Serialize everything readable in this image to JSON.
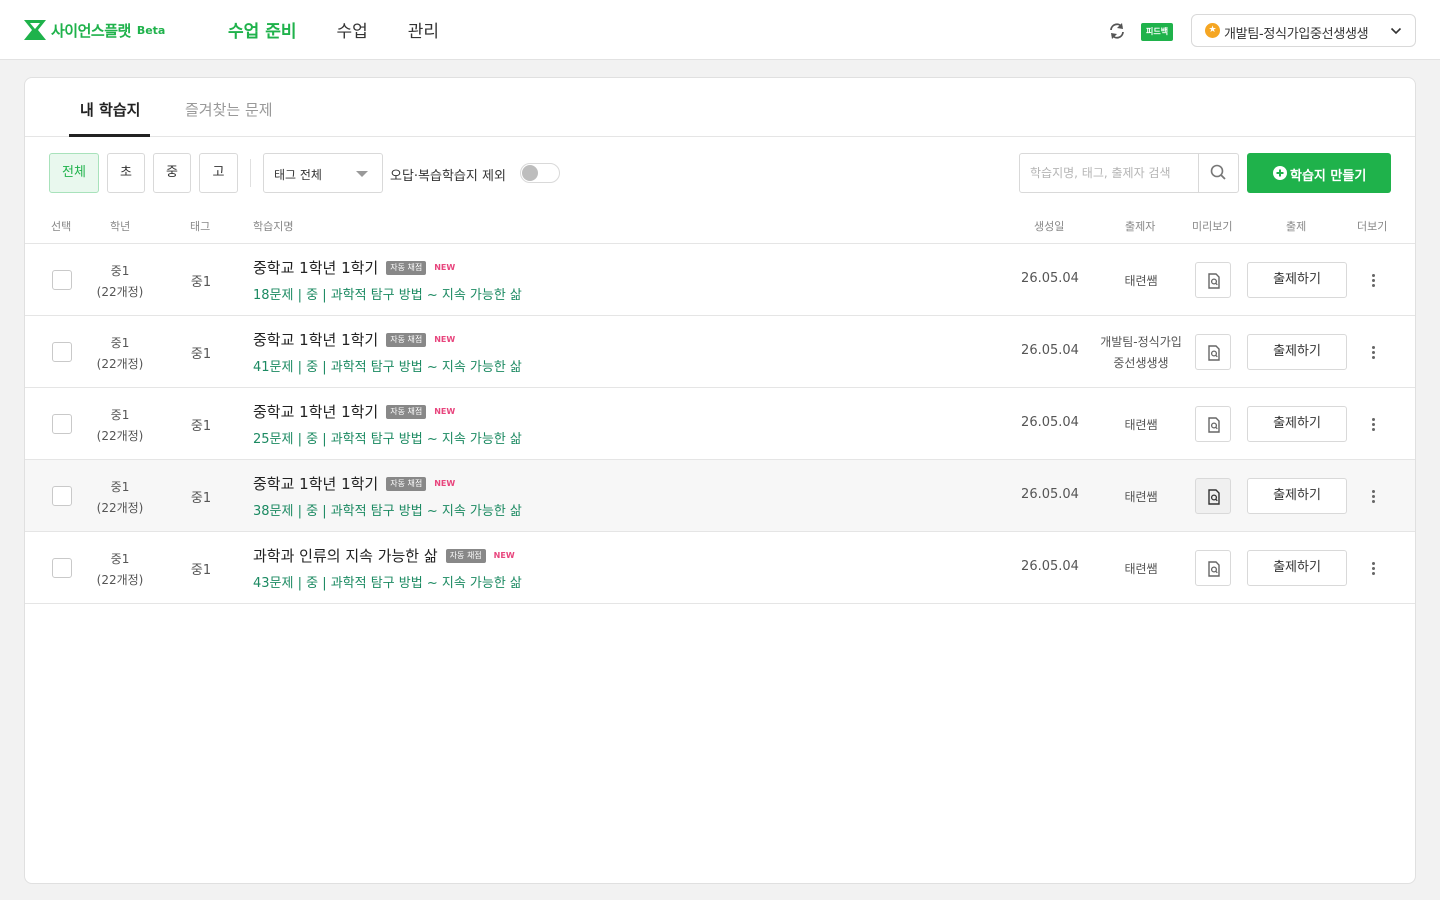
{
  "header": {
    "logo_text": "사이언스플랫",
    "logo_beta": "Beta",
    "menu": [
      {
        "label": "수업 준비",
        "active": true
      },
      {
        "label": "수업",
        "active": false
      },
      {
        "label": "관리",
        "active": false
      }
    ],
    "refresh_icon": "refresh-icon",
    "feedback_label": "피드백",
    "account_name": "개발팀-정식가입중선생생생",
    "brand_color": "#1fb24b"
  },
  "tabs": [
    {
      "label": "내 학습지",
      "active": true
    },
    {
      "label": "즐겨찾는 문제",
      "active": false
    }
  ],
  "filters": {
    "levels": [
      {
        "label": "전체",
        "active": true
      },
      {
        "label": "초",
        "active": false
      },
      {
        "label": "중",
        "active": false
      },
      {
        "label": "고",
        "active": false
      }
    ],
    "tag_select_value": "태그 전체",
    "exclude_label": "오답·복습학습지 제외",
    "exclude_enabled": false,
    "search_placeholder": "학습지명, 태그, 출제자 검색",
    "create_button": "학습지 만들기"
  },
  "table": {
    "columns": {
      "select": "선택",
      "grade": "학년",
      "tag": "태그",
      "name": "학습지명",
      "created": "생성일",
      "author": "출제자",
      "preview": "미리보기",
      "assign": "출제",
      "more": "더보기"
    },
    "auto_grade_badge": "자동 채점",
    "new_badge": "NEW",
    "assign_label": "출제하기",
    "rows": [
      {
        "grade": "중1",
        "curriculum": "(22개정)",
        "tag": "중1",
        "title": "중학교 1학년 1학기",
        "desc": "18문제 | 중 | 과학적 탐구 방법 ~ 지속 가능한 삶",
        "date": "26.05.04",
        "author_line1": "태련쌤",
        "author_line2": ""
      },
      {
        "grade": "중1",
        "curriculum": "(22개정)",
        "tag": "중1",
        "title": "중학교 1학년 1학기",
        "desc": "41문제 | 중 | 과학적 탐구 방법 ~ 지속 가능한 삶",
        "date": "26.05.04",
        "author_line1": "개발팀-정식가입",
        "author_line2": "중선생생생"
      },
      {
        "grade": "중1",
        "curriculum": "(22개정)",
        "tag": "중1",
        "title": "중학교 1학년 1학기",
        "desc": "25문제 | 중 | 과학적 탐구 방법 ~ 지속 가능한 삶",
        "date": "26.05.04",
        "author_line1": "태련쌤",
        "author_line2": ""
      },
      {
        "grade": "중1",
        "curriculum": "(22개정)",
        "tag": "중1",
        "title": "중학교 1학년 1학기",
        "desc": "38문제 | 중 | 과학적 탐구 방법 ~ 지속 가능한 삶",
        "date": "26.05.04",
        "author_line1": "태련쌤",
        "author_line2": ""
      },
      {
        "grade": "중1",
        "curriculum": "(22개정)",
        "tag": "중1",
        "title": "과학과 인류의 지속 가능한 삶",
        "desc": "43문제 | 중 | 과학적 탐구 방법 ~ 지속 가능한 삶",
        "date": "26.05.04",
        "author_line1": "태련쌤",
        "author_line2": ""
      }
    ]
  }
}
